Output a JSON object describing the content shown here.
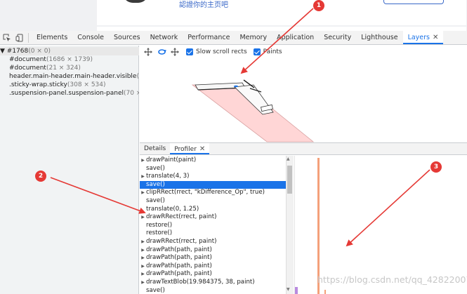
{
  "page_top": {
    "snippet_text": "認證你的主页吧"
  },
  "devtools": {
    "tabs": [
      {
        "label": "Elements",
        "active": false
      },
      {
        "label": "Console",
        "active": false
      },
      {
        "label": "Sources",
        "active": false
      },
      {
        "label": "Network",
        "active": false
      },
      {
        "label": "Performance",
        "active": false
      },
      {
        "label": "Memory",
        "active": false
      },
      {
        "label": "Application",
        "active": false
      },
      {
        "label": "Security",
        "active": false
      },
      {
        "label": "Lighthouse",
        "active": false
      },
      {
        "label": "Layers",
        "active": true
      }
    ],
    "close_glyph": "✕"
  },
  "layer_tree": {
    "rows": [
      {
        "prefix": "▼ ",
        "text": "#1768",
        "dim": "(0 × 0)"
      },
      {
        "prefix": "",
        "text": "#document",
        "dim": "(1686 × 1739)"
      },
      {
        "prefix": "",
        "text": "#document",
        "dim": "(21 × 324)"
      },
      {
        "prefix": "",
        "text": "header.main-header.main-header.visible",
        "dim": "(1686 ×"
      },
      {
        "prefix": "",
        "text": ".sticky-wrap.sticky",
        "dim": "(308 × 534)"
      },
      {
        "prefix": "",
        "text": ".suspension-panel.suspension-panel",
        "dim": "(70 × 75)"
      }
    ]
  },
  "layers_toolbar": {
    "slow_scroll_label": "Slow scroll rects",
    "paints_label": "Paints"
  },
  "sub_tabs": [
    {
      "label": "Details",
      "active": false
    },
    {
      "label": "Profiler",
      "active": true
    }
  ],
  "profiler": {
    "rows": [
      {
        "expand": true,
        "text": "drawPaint(paint)",
        "selected": false
      },
      {
        "expand": false,
        "text": "save()",
        "selected": false
      },
      {
        "expand": true,
        "text": "translate(4, 3)",
        "selected": false
      },
      {
        "expand": false,
        "text": "save()",
        "selected": true
      },
      {
        "expand": true,
        "text": "clipRRect(rrect, \"kDifference_Op\", true)",
        "selected": false
      },
      {
        "expand": false,
        "text": "save()",
        "selected": false
      },
      {
        "expand": false,
        "text": "translate(0, 1.25)",
        "selected": false
      },
      {
        "expand": true,
        "text": "drawRRect(rrect, paint)",
        "selected": false
      },
      {
        "expand": false,
        "text": "restore()",
        "selected": false
      },
      {
        "expand": false,
        "text": "restore()",
        "selected": false
      },
      {
        "expand": true,
        "text": "drawRRect(rrect, paint)",
        "selected": false
      },
      {
        "expand": true,
        "text": "drawPath(path, paint)",
        "selected": false
      },
      {
        "expand": true,
        "text": "drawPath(path, paint)",
        "selected": false
      },
      {
        "expand": true,
        "text": "drawPath(path, paint)",
        "selected": false
      },
      {
        "expand": true,
        "text": "drawPath(path, paint)",
        "selected": false
      },
      {
        "expand": true,
        "text": "drawTextBlob(19.984375, 38, paint)",
        "selected": false
      },
      {
        "expand": false,
        "text": "save()",
        "selected": false
      }
    ]
  },
  "annotations": [
    {
      "label": "1"
    },
    {
      "label": "2"
    },
    {
      "label": "3"
    }
  ],
  "watermark": "https://blog.csdn.net/qq_42822007",
  "colors": {
    "accent": "#1a73e8",
    "annotation_red": "#e53935",
    "timeline_bar": "#f4a07a",
    "layer_fill": "#ffd6d6"
  }
}
